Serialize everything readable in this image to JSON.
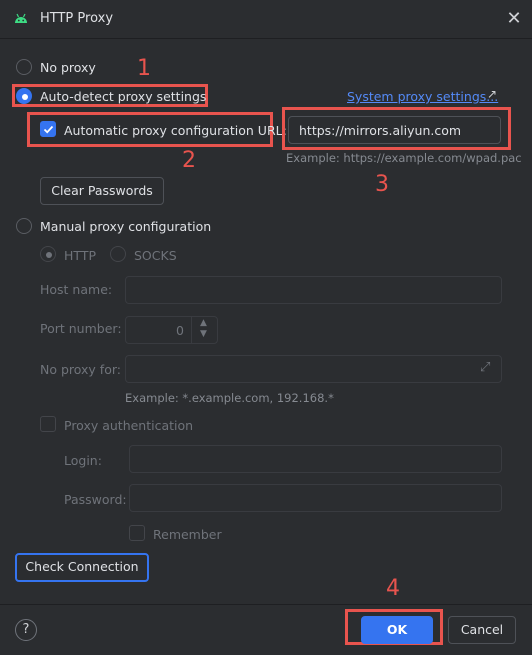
{
  "window": {
    "title": "HTTP Proxy"
  },
  "options": {
    "no_proxy": "No proxy",
    "auto_detect": "Auto-detect proxy settings",
    "system_link": "System proxy settings...",
    "auto_config_label": "Automatic proxy configuration URL:",
    "auto_config_value": "https://mirrors.aliyun.com",
    "auto_config_example": "Example: https://example.com/wpad.pac",
    "clear_passwords": "Clear Passwords",
    "manual": "Manual proxy configuration"
  },
  "manual": {
    "http": "HTTP",
    "socks": "SOCKS",
    "host_label": "Host name:",
    "port_label": "Port number:",
    "port_value": "0",
    "no_proxy_label": "No proxy for:",
    "no_proxy_example": "Example: *.example.com, 192.168.*",
    "proxy_auth": "Proxy authentication",
    "login_label": "Login:",
    "password_label": "Password:",
    "remember": "Remember"
  },
  "buttons": {
    "check_connection": "Check Connection",
    "ok": "OK",
    "cancel": "Cancel",
    "help": "?"
  },
  "annotations": {
    "n1": "1",
    "n2": "2",
    "n3": "3",
    "n4": "4"
  },
  "colors": {
    "accent": "#3574f0",
    "annotation": "#e8544e",
    "background": "#2b2d30",
    "link": "#548af7"
  },
  "icons": {
    "app": "android-icon",
    "close": "close-icon",
    "external": "arrow-up-right-icon",
    "expand": "expand-icon"
  }
}
